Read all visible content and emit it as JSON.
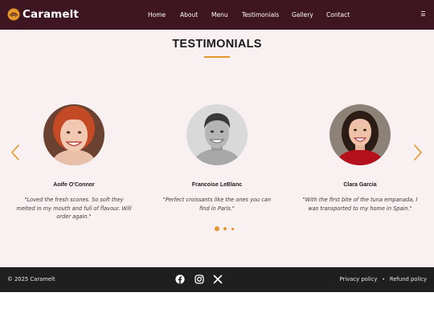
{
  "brand": {
    "name": "Caramelt",
    "logo_icon": "croissant-icon"
  },
  "nav": {
    "items": [
      {
        "label": "Home"
      },
      {
        "label": "About"
      },
      {
        "label": "Menu"
      },
      {
        "label": "Testimonials"
      },
      {
        "label": "Gallery"
      },
      {
        "label": "Contact"
      }
    ],
    "menu_icon": "hamburger-icon"
  },
  "testimonials": {
    "title": "TESTIMONIALS",
    "items": [
      {
        "name": "Aoife O'Connor",
        "quote": "\"Loved the fresh scones. So soft they melted in my mouth and full of flavour. Will order again.\""
      },
      {
        "name": "Francoise LeBlanc",
        "quote": "\"Perfect croissants like the ones you can find in Paris.\""
      },
      {
        "name": "Clara Garcia",
        "quote": "\"With the first bite of the tuna empanada, I was transported to my home in Spain.\""
      }
    ],
    "prev_icon": "chevron-left-icon",
    "next_icon": "chevron-right-icon",
    "pagination": {
      "pages": 3,
      "active": 1
    }
  },
  "footer": {
    "copyright": "© 2025 Caramelt",
    "social": [
      "facebook-icon",
      "instagram-icon",
      "x-icon"
    ],
    "links": [
      {
        "label": "Privacy policy"
      },
      {
        "label": "Refund policy"
      }
    ],
    "separator": "•"
  },
  "colors": {
    "header_bg": "#3d1621",
    "section_bg": "#f8f0f1",
    "accent": "#e3962a",
    "footer_bg": "#1f1f1f"
  }
}
